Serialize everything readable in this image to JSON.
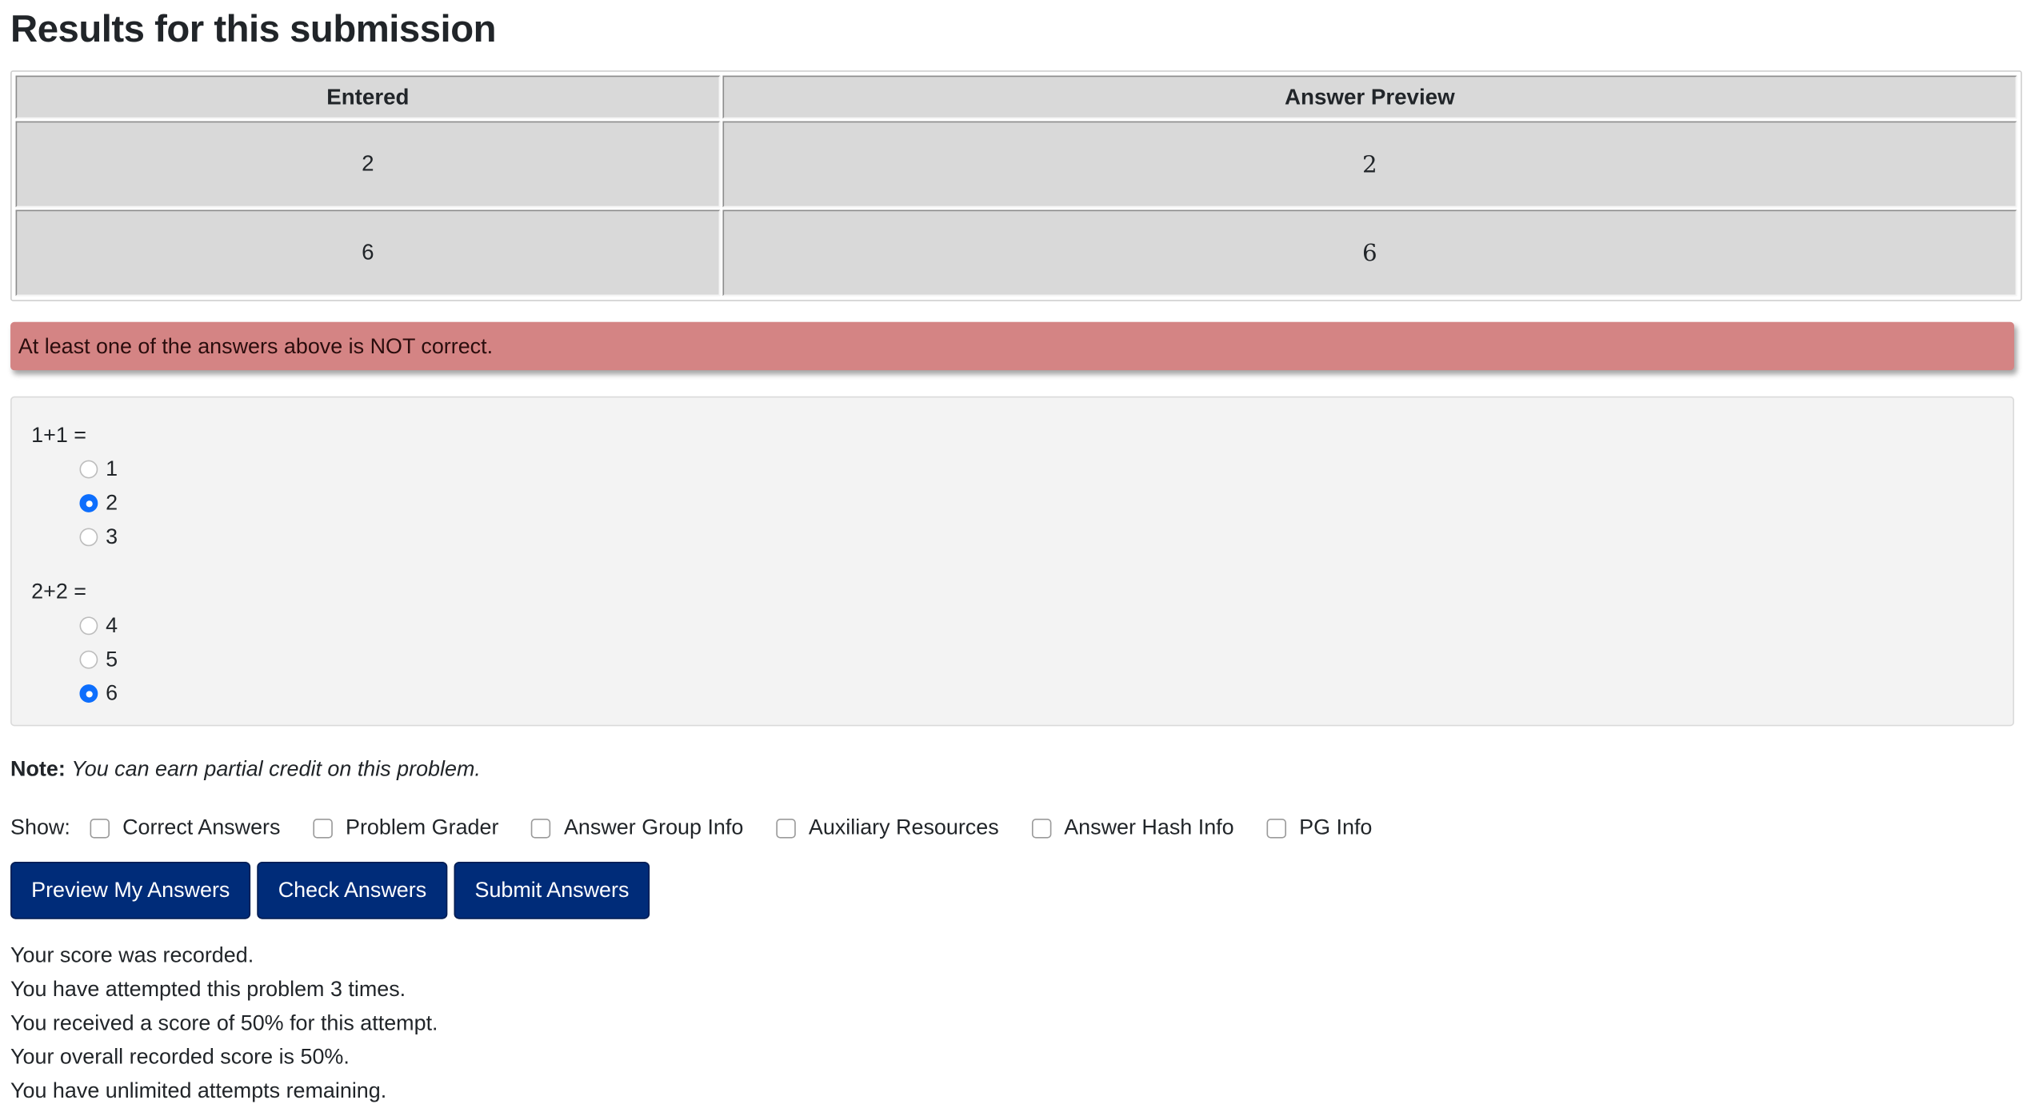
{
  "results": {
    "title": "Results for this submission",
    "headers": [
      "Entered",
      "Answer Preview"
    ],
    "rows": [
      {
        "entered": "2",
        "preview": "2"
      },
      {
        "entered": "6",
        "preview": "6"
      }
    ]
  },
  "alert": {
    "text": "At least one of the answers above is NOT correct.",
    "color": "#d48484"
  },
  "problem": {
    "questions": [
      {
        "text": "1+1 =",
        "choices": [
          {
            "label": "1",
            "checked": false
          },
          {
            "label": "2",
            "checked": true
          },
          {
            "label": "3",
            "checked": false
          }
        ]
      },
      {
        "text": "2+2 =",
        "choices": [
          {
            "label": "4",
            "checked": false
          },
          {
            "label": "5",
            "checked": false
          },
          {
            "label": "6",
            "checked": true
          }
        ]
      }
    ]
  },
  "note": {
    "label": "Note:",
    "text": "You can earn partial credit on this problem."
  },
  "show": {
    "label": "Show:",
    "options": [
      {
        "label": "Correct Answers",
        "checked": false
      },
      {
        "label": "Problem Grader",
        "checked": false
      },
      {
        "label": "Answer Group Info",
        "checked": false
      },
      {
        "label": "Auxiliary Resources",
        "checked": false
      },
      {
        "label": "Answer Hash Info",
        "checked": false
      },
      {
        "label": "PG Info",
        "checked": false
      }
    ]
  },
  "buttons": {
    "preview": "Preview My Answers",
    "check": "Check Answers",
    "submit": "Submit Answers",
    "color": "#002c79"
  },
  "score": {
    "lines": [
      "Your score was recorded.",
      "You have attempted this problem 3 times.",
      "You received a score of 50% for this attempt.",
      "Your overall recorded score is 50%.",
      "You have unlimited attempts remaining."
    ]
  }
}
